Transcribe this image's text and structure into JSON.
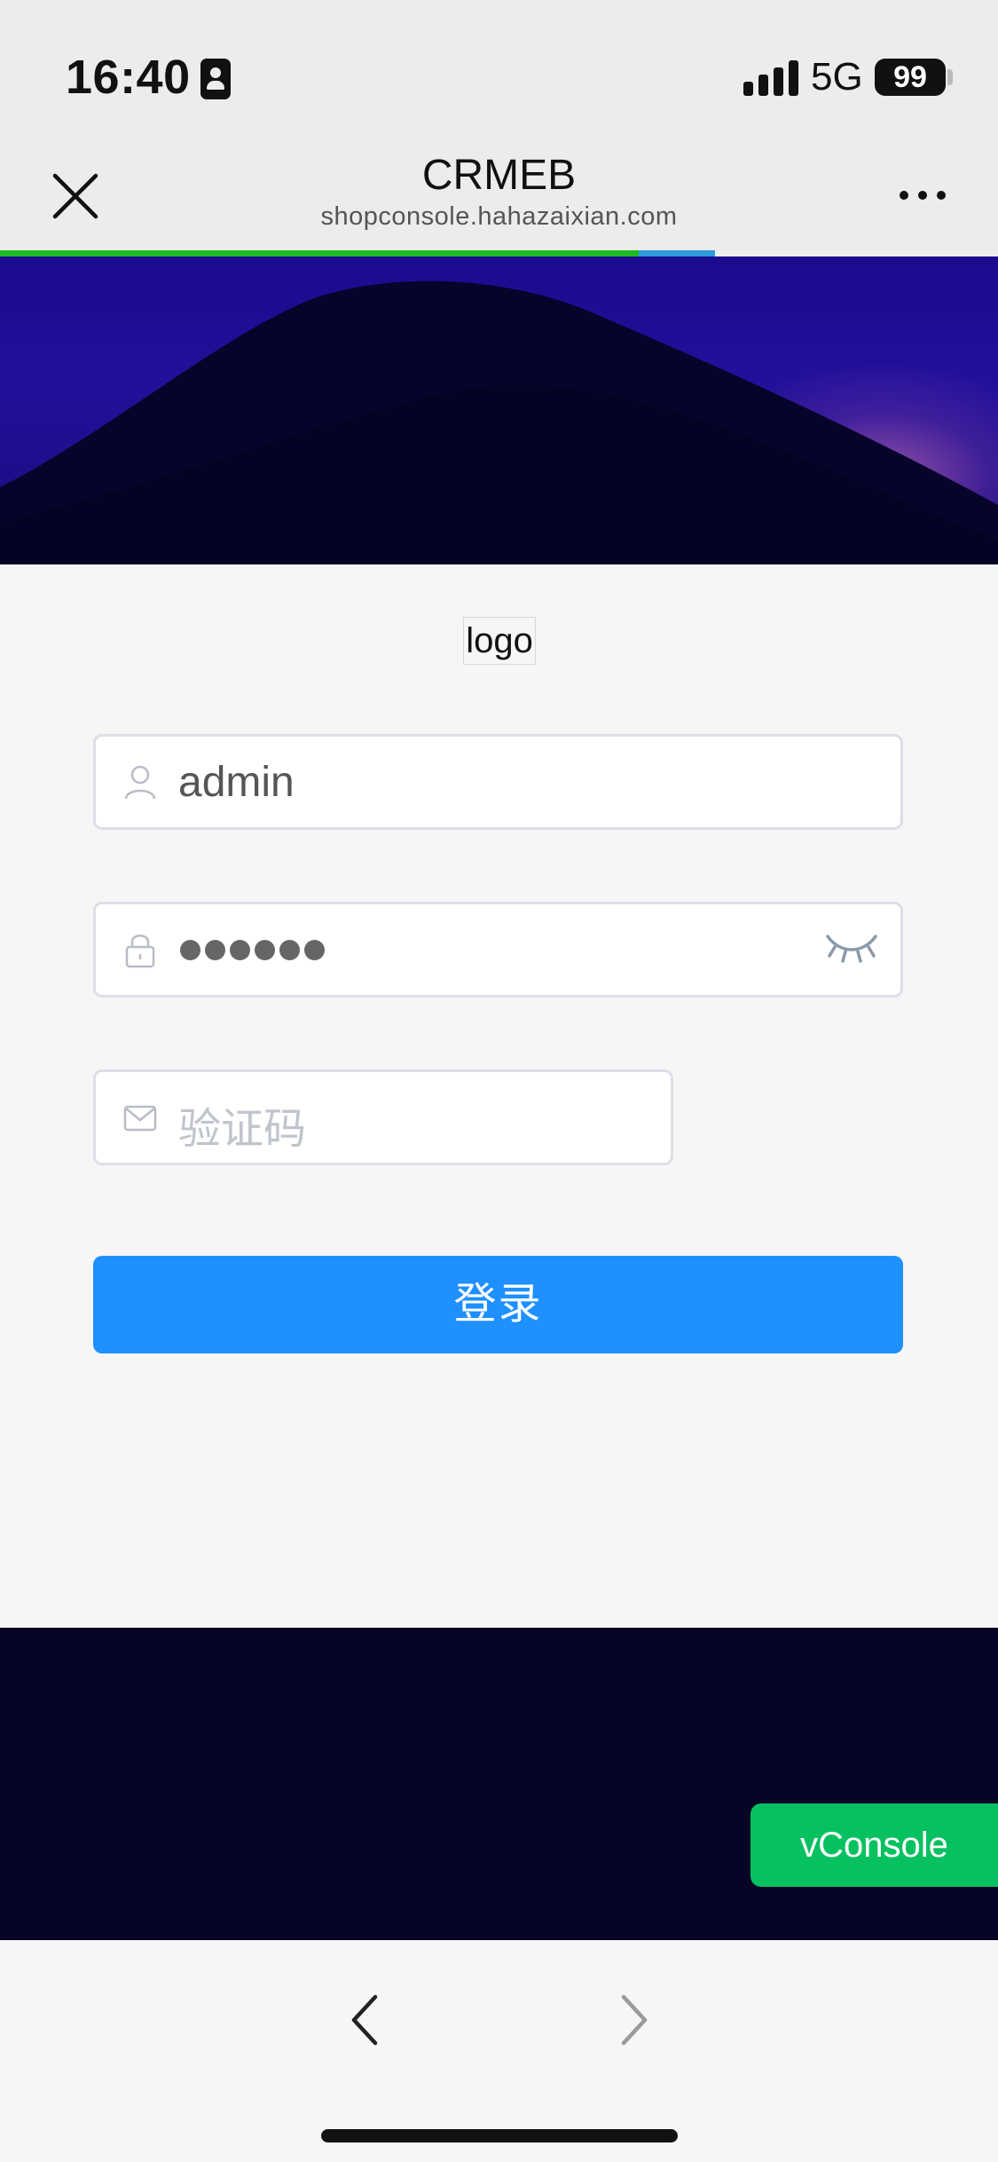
{
  "status_bar": {
    "time": "16:40",
    "network": "5G",
    "battery": "99",
    "icons": [
      "id-badge-icon",
      "signal-icon",
      "battery-icon"
    ]
  },
  "nav": {
    "title": "CRMEB",
    "url": "shopconsole.hahazaixian.com",
    "icons": [
      "close-icon",
      "more-icon"
    ]
  },
  "page_load_progress": 0.64,
  "login": {
    "logo_text": "logo",
    "username": {
      "value": "admin",
      "icon": "user-icon"
    },
    "password": {
      "masked_length": 6,
      "icon": "lock-icon",
      "toggle_icon": "eye-closed-icon"
    },
    "captcha": {
      "placeholder": "验证码",
      "icon": "mail-icon"
    },
    "submit_label": "登录"
  },
  "vconsole_label": "vConsole",
  "bottom_bar": {
    "icons": [
      "back-arrow-icon",
      "forward-arrow-icon"
    ]
  },
  "colors": {
    "primary": "#1e90ff",
    "vconsole": "#07c160",
    "progress": "#1fb922",
    "hero_sky": "#1a0b8e",
    "hero_dark": "#070526"
  }
}
